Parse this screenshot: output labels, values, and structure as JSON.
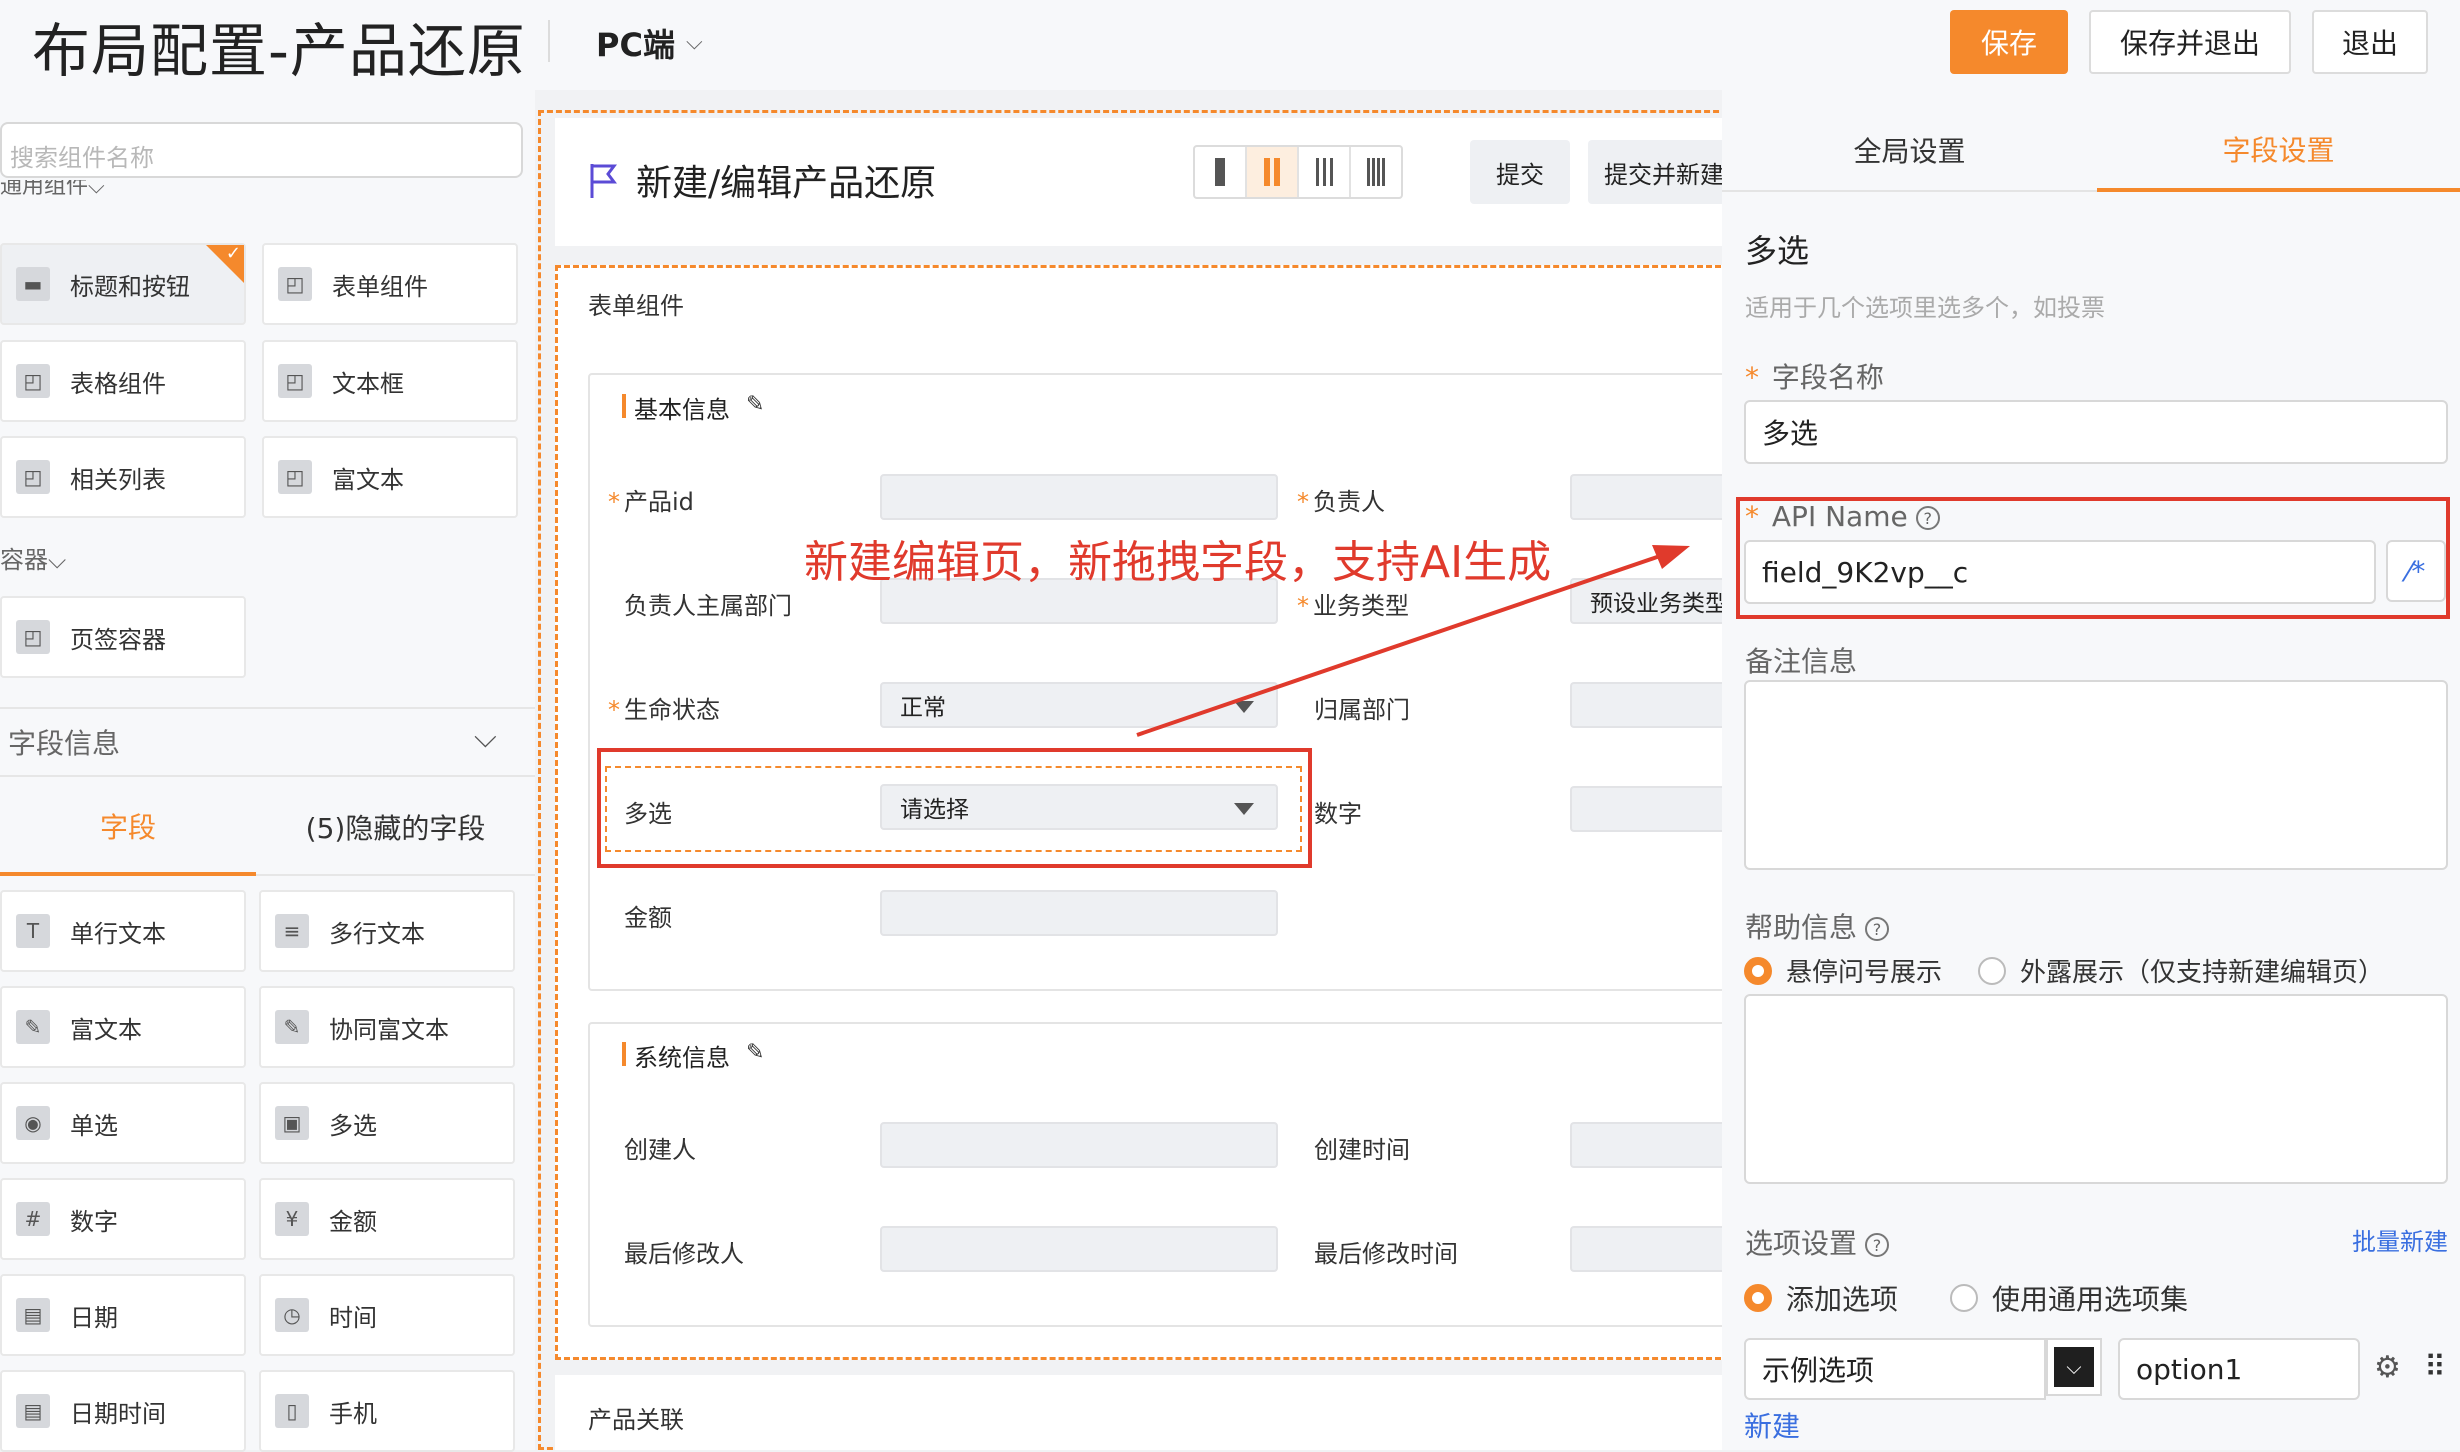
{
  "header": {
    "title": "布局配置-产品还原",
    "platform": "PC端",
    "save": "保存",
    "save_exit": "保存并退出",
    "exit": "退出"
  },
  "left_panel": {
    "search_placeholder": "搜索组件名称",
    "group_common": "通用组件",
    "common_components": [
      {
        "label": "标题和按钮"
      },
      {
        "label": "表单组件"
      },
      {
        "label": "表格组件"
      },
      {
        "label": "文本框"
      },
      {
        "label": "相关列表"
      },
      {
        "label": "富文本"
      }
    ],
    "group_container": "容器",
    "container_components": [
      {
        "label": "页签容器"
      }
    ],
    "field_info_title": "字段信息",
    "tabs": {
      "fields": "字段",
      "hidden": "(5)隐藏的字段"
    },
    "field_types": [
      {
        "label": "单行文本",
        "icon": "text-icon"
      },
      {
        "label": "多行文本",
        "icon": "lines-icon"
      },
      {
        "label": "富文本",
        "icon": "edit-icon"
      },
      {
        "label": "协同富文本",
        "icon": "edit-icon"
      },
      {
        "label": "单选",
        "icon": "radio-icon"
      },
      {
        "label": "多选",
        "icon": "checkbox-icon"
      },
      {
        "label": "数字",
        "icon": "hash-icon"
      },
      {
        "label": "金额",
        "icon": "yen-icon"
      },
      {
        "label": "日期",
        "icon": "calendar-icon"
      },
      {
        "label": "时间",
        "icon": "clock-icon"
      },
      {
        "label": "日期时间",
        "icon": "calendar-icon"
      },
      {
        "label": "手机",
        "icon": "phone-icon"
      }
    ]
  },
  "canvas": {
    "form_title": "新建/编辑产品还原",
    "submit": "提交",
    "submit_new": "提交并新建",
    "section_label": "表单组件",
    "basic_info": {
      "title": "基本信息",
      "fields": {
        "product_id": "产品id",
        "owner": "负责人",
        "owner_dept": "负责人主属部门",
        "biz_type": "业务类型",
        "biz_type_value": "预设业务类型",
        "lifecycle": "生命状态",
        "lifecycle_value": "正常",
        "belong_dept": "归属部门",
        "multi": "多选",
        "multi_placeholder": "请选择",
        "number": "数字",
        "amount": "金额"
      }
    },
    "system_info": {
      "title": "系统信息",
      "fields": {
        "creator": "创建人",
        "create_time": "创建时间",
        "modifier": "最后修改人",
        "modify_time": "最后修改时间"
      }
    },
    "product_relation": "产品关联"
  },
  "annotation": {
    "text": "新建编辑页，新拖拽字段，支持AI生成",
    "color": "#e03a2c"
  },
  "right_panel": {
    "tab_global": "全局设置",
    "tab_field": "字段设置",
    "field_type": "多选",
    "field_type_desc": "适用于几个选项里选多个，如投票",
    "field_name_label": "字段名称",
    "field_name_value": "多选",
    "api_name_label": "API Name",
    "api_name_value": "field_9K2vp__c",
    "remark_label": "备注信息",
    "help_label": "帮助信息",
    "help_opt_hover": "悬停问号展示",
    "help_opt_external": "外露展示（仅支持新建编辑页）",
    "options_label": "选项设置",
    "batch_add": "批量新建",
    "opt_add": "添加选项",
    "opt_use_common": "使用通用选项集",
    "option_label_value": "示例选项",
    "option_api_value": "option1",
    "add_new": "新建"
  },
  "colors": {
    "accent": "#f5892c",
    "link": "#3a6fe0"
  }
}
